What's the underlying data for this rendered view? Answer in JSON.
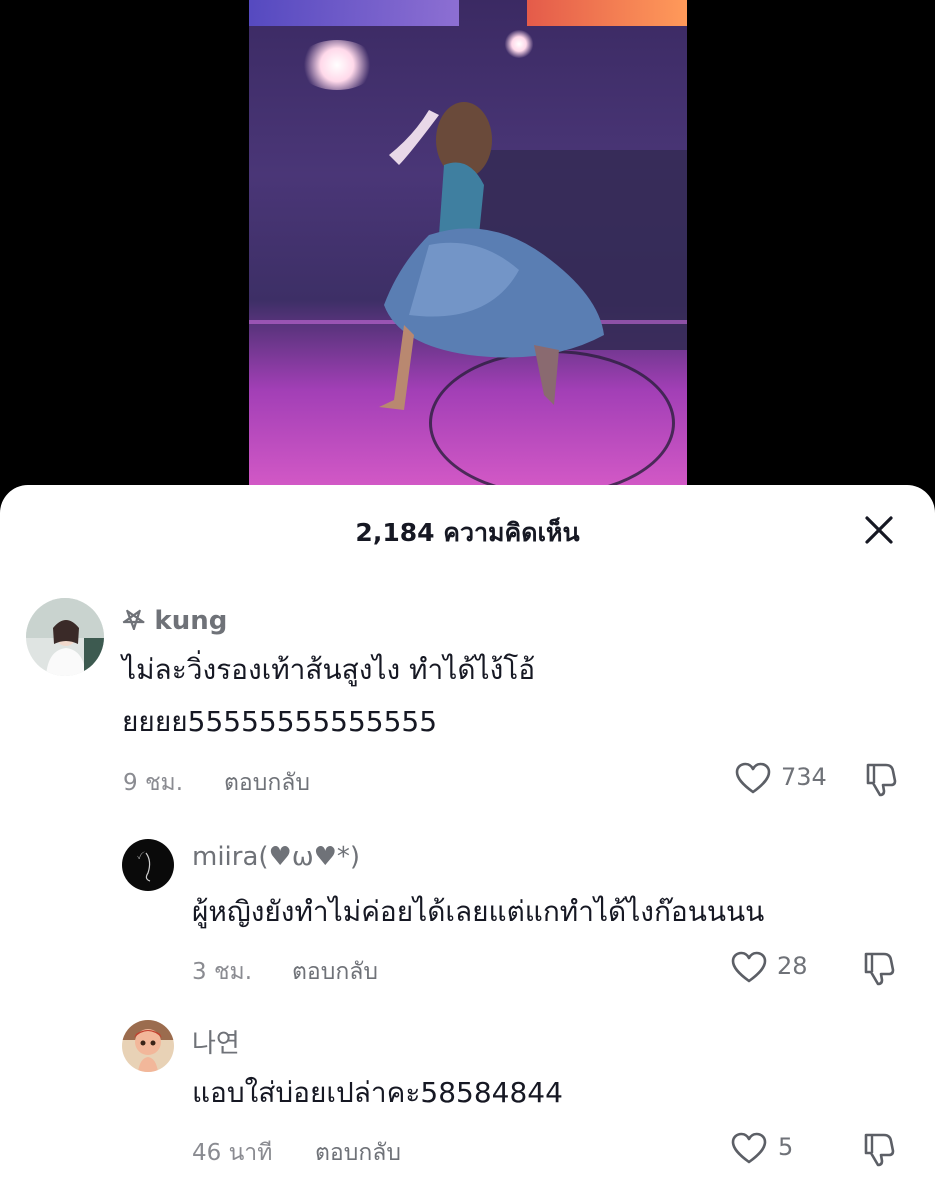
{
  "header": {
    "comment_count": "2,184",
    "title_suffix": "ความคิดเห็น"
  },
  "comments": [
    {
      "username": "𖤐 kung",
      "text_line1": "ไม่ละวิ่งรองเท้าส้นสูงไง ทำได้ไง้โอ้",
      "text_line2": "ยยยย55555555555555",
      "time": "9 ชม.",
      "reply_label": "ตอบกลับ",
      "likes": "734"
    },
    {
      "username": "miira(♥ω♥*)",
      "text": "ผู้หญิงยังทำไม่ค่อยได้เลยแต่แกทำได้ไงก๊อนนนน",
      "time": "3 ชม.",
      "reply_label": "ตอบกลับ",
      "likes": "28"
    },
    {
      "username": "나연",
      "text": "แอบใส่บ่อยเปล่าคะ58584844",
      "time": "46 นาที",
      "reply_label": "ตอบกลับ",
      "likes": "5"
    }
  ],
  "icons": {
    "close": "close-icon",
    "like": "heart-outline-icon",
    "dislike": "thumbs-down-icon"
  },
  "colors": {
    "text": "#161823",
    "muted": "#8a8b91",
    "sheet_bg": "#ffffff"
  }
}
